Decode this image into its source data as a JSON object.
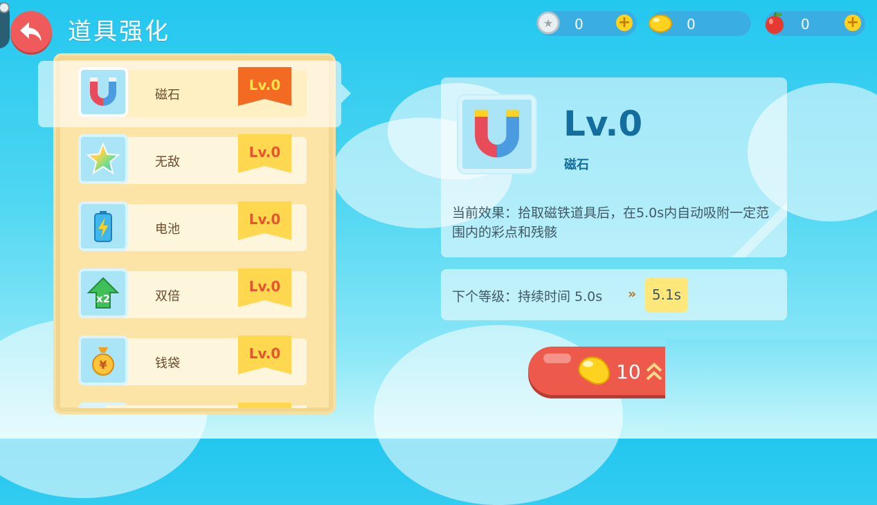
{
  "header": {
    "title": "道具强化",
    "back_icon": "back-arrow-icon"
  },
  "currencies": [
    {
      "icon": "silver-coin-icon",
      "value": "0",
      "plus": "+"
    },
    {
      "icon": "jellybean-icon",
      "value": "0"
    },
    {
      "icon": "apple-icon",
      "value": "0",
      "plus": "+"
    }
  ],
  "items": [
    {
      "name": "磁石",
      "level": "Lv.0",
      "icon": "magnet-icon",
      "selected": true
    },
    {
      "name": "无敌",
      "level": "Lv.0",
      "icon": "rainbow-star-icon"
    },
    {
      "name": "电池",
      "level": "Lv.0",
      "icon": "battery-icon"
    },
    {
      "name": "双倍",
      "level": "Lv.0",
      "icon": "double-arrow-x2-icon"
    },
    {
      "name": "钱袋",
      "level": "Lv.0",
      "icon": "money-bag-icon"
    }
  ],
  "detail": {
    "level": "Lv.0",
    "name": "磁石",
    "effect": "当前效果：拾取磁铁道具后，在5.0s内自动吸附一定范围内的彩点和残骸",
    "next_label": "下个等级：持续时间 5.0s",
    "next_arrow": "»",
    "next_value": "5.1s"
  },
  "upgrade": {
    "cost": "10",
    "icon": "jellybean-icon"
  },
  "colors": {
    "selected_level_badge": "#f36a22",
    "level_badge": "#ffd84f",
    "accent_blue": "#136d9e",
    "back_button": "#ef5a5a"
  }
}
